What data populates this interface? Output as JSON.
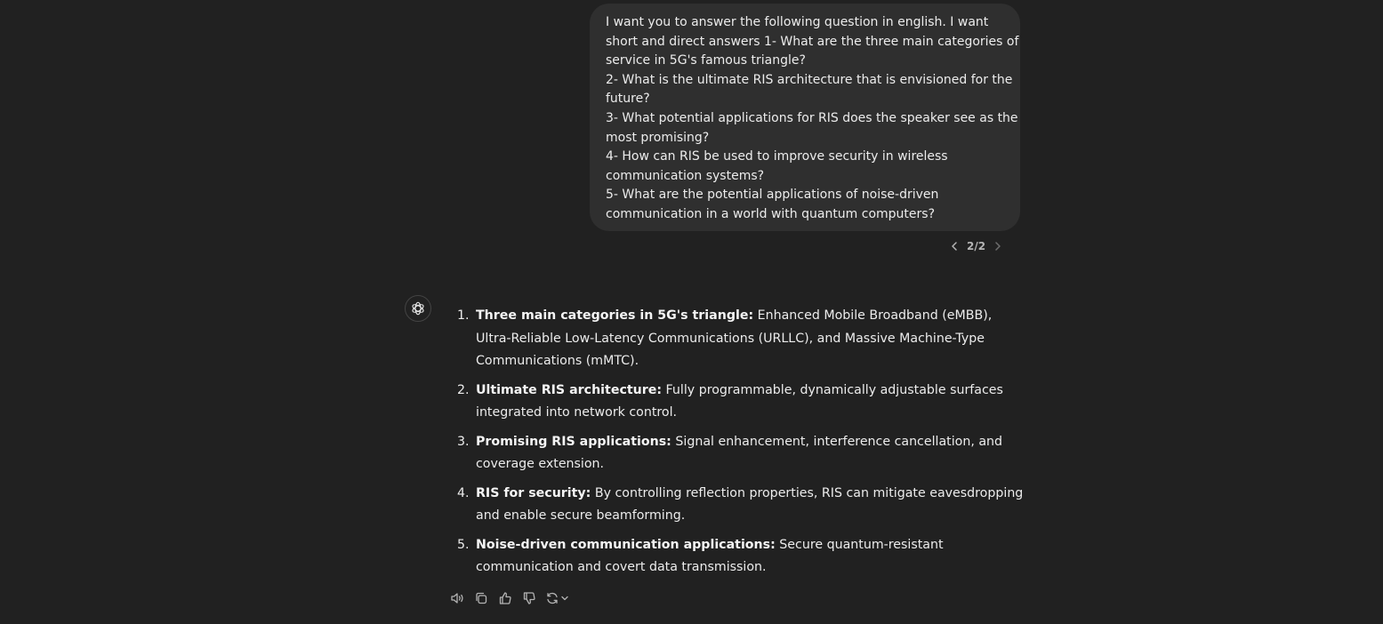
{
  "user_message": {
    "lines": [
      "I  want you to answer the following question in english. I want",
      "short and direct answers 1- What are the three main categories of",
      "service in 5G's famous triangle?",
      "2- What is the ultimate RIS architecture that is envisioned for the",
      "future?",
      "3- What potential applications for RIS does the speaker see as the",
      "most promising?",
      "4- How can RIS be used to improve security in wireless",
      "communication systems?",
      "5- What are the potential applications of noise-driven",
      "communication in a world with quantum computers?"
    ]
  },
  "pager": {
    "label": "2/2"
  },
  "answer": {
    "items": [
      {
        "num": "1.",
        "term": "Three main categories in 5G's triangle:",
        "text": " Enhanced Mobile Broadband (eMBB), Ultra-Reliable Low-Latency Communications (URLLC), and Massive Machine-Type Communications (mMTC)."
      },
      {
        "num": "2.",
        "term": "Ultimate RIS architecture:",
        "text": " Fully programmable, dynamically adjustable surfaces integrated into network control."
      },
      {
        "num": "3.",
        "term": "Promising RIS applications:",
        "text": " Signal enhancement, interference cancellation, and coverage extension."
      },
      {
        "num": "4.",
        "term": "RIS for security:",
        "text": " By controlling reflection properties, RIS can mitigate eavesdropping and enable secure beamforming."
      },
      {
        "num": "5.",
        "term": "Noise-driven communication applications:",
        "text": " Secure quantum-resistant communication and covert data transmission."
      }
    ]
  },
  "actions": {
    "icons": [
      "speaker-icon",
      "copy-icon",
      "thumbs-up-icon",
      "thumbs-down-icon",
      "regenerate-icon"
    ]
  },
  "colors": {
    "background": "#212121",
    "bubble": "#2f2f2f",
    "text": "#ececec",
    "muted": "#b4b4b4"
  }
}
